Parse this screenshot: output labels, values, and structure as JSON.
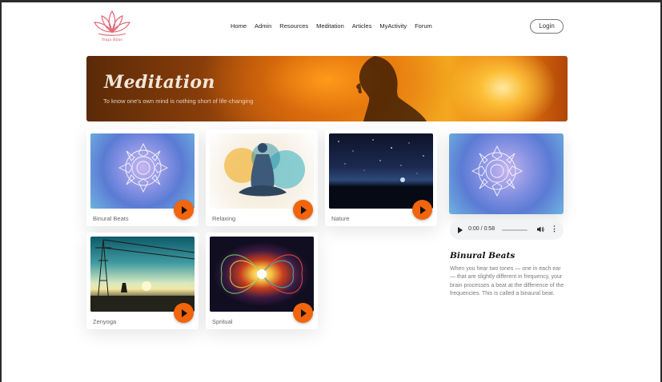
{
  "brand": {
    "name": "Yoga Bliss",
    "accent": "#f2650c",
    "logo_color": "#e06878"
  },
  "nav": {
    "items": [
      {
        "label": "Home"
      },
      {
        "label": "Admin"
      },
      {
        "label": "Resources"
      },
      {
        "label": "Meditation"
      },
      {
        "label": "Articles"
      },
      {
        "label": "MyActivity"
      },
      {
        "label": "Forum"
      }
    ],
    "login_label": "Login"
  },
  "hero": {
    "title": "Meditation",
    "subtitle": "To know one's own mind is nothing short of life-changing"
  },
  "tracks": [
    {
      "label": "Binural Beats",
      "icon": "play-icon"
    },
    {
      "label": "Relaxing",
      "icon": "play-icon"
    },
    {
      "label": "Nature",
      "icon": "play-icon"
    },
    {
      "label": "Zenyoga",
      "icon": "play-icon"
    },
    {
      "label": "Spritual",
      "icon": "play-icon"
    }
  ],
  "player": {
    "time": "0:00 / 0:58",
    "progress": 0,
    "title": "Binural Beats",
    "description": "When you hear two tones — one in each ear — that are slightly different in frequency, your brain processes a beat at the difference of the frequencies. This is called a binaural beat."
  }
}
